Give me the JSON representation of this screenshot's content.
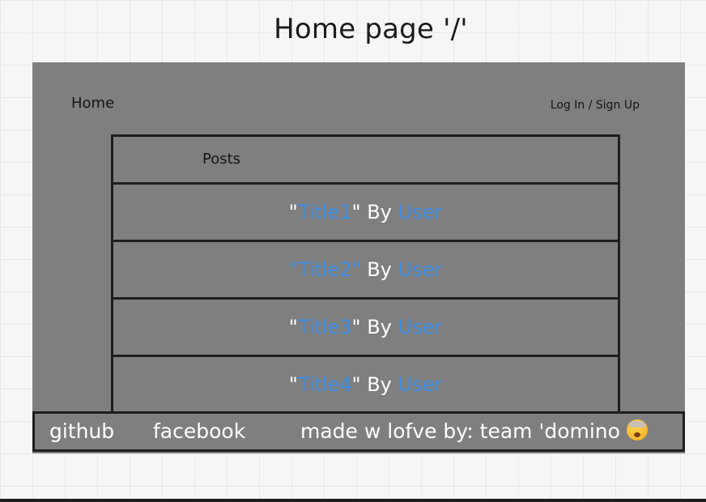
{
  "heading": "Home page '/'",
  "nav": {
    "home": "Home",
    "login": "Log In / Sign Up"
  },
  "posts": {
    "header": "Posts",
    "items": [
      {
        "open_quote": "\"",
        "title": "Title1",
        "close_quote": "\"",
        "by": " By ",
        "user": "User"
      },
      {
        "open_quote": "",
        "title": "\"Title2\"",
        "close_quote": "",
        "by": " By ",
        "user": "User"
      },
      {
        "open_quote": "\"",
        "title": "Title3",
        "close_quote": "\"",
        "by": " By ",
        "user": "User"
      },
      {
        "open_quote": "\"",
        "title": "Title4",
        "close_quote": "\"",
        "by": " By ",
        "user": "User"
      }
    ]
  },
  "footer": {
    "github": "github",
    "facebook": "facebook",
    "credit": "made w lofve by: team 'domino",
    "emoji": "exploding-head-icon"
  },
  "colors": {
    "link": "#3b8de6",
    "panel": "#7f7f7f",
    "border": "#1e1e1e"
  }
}
